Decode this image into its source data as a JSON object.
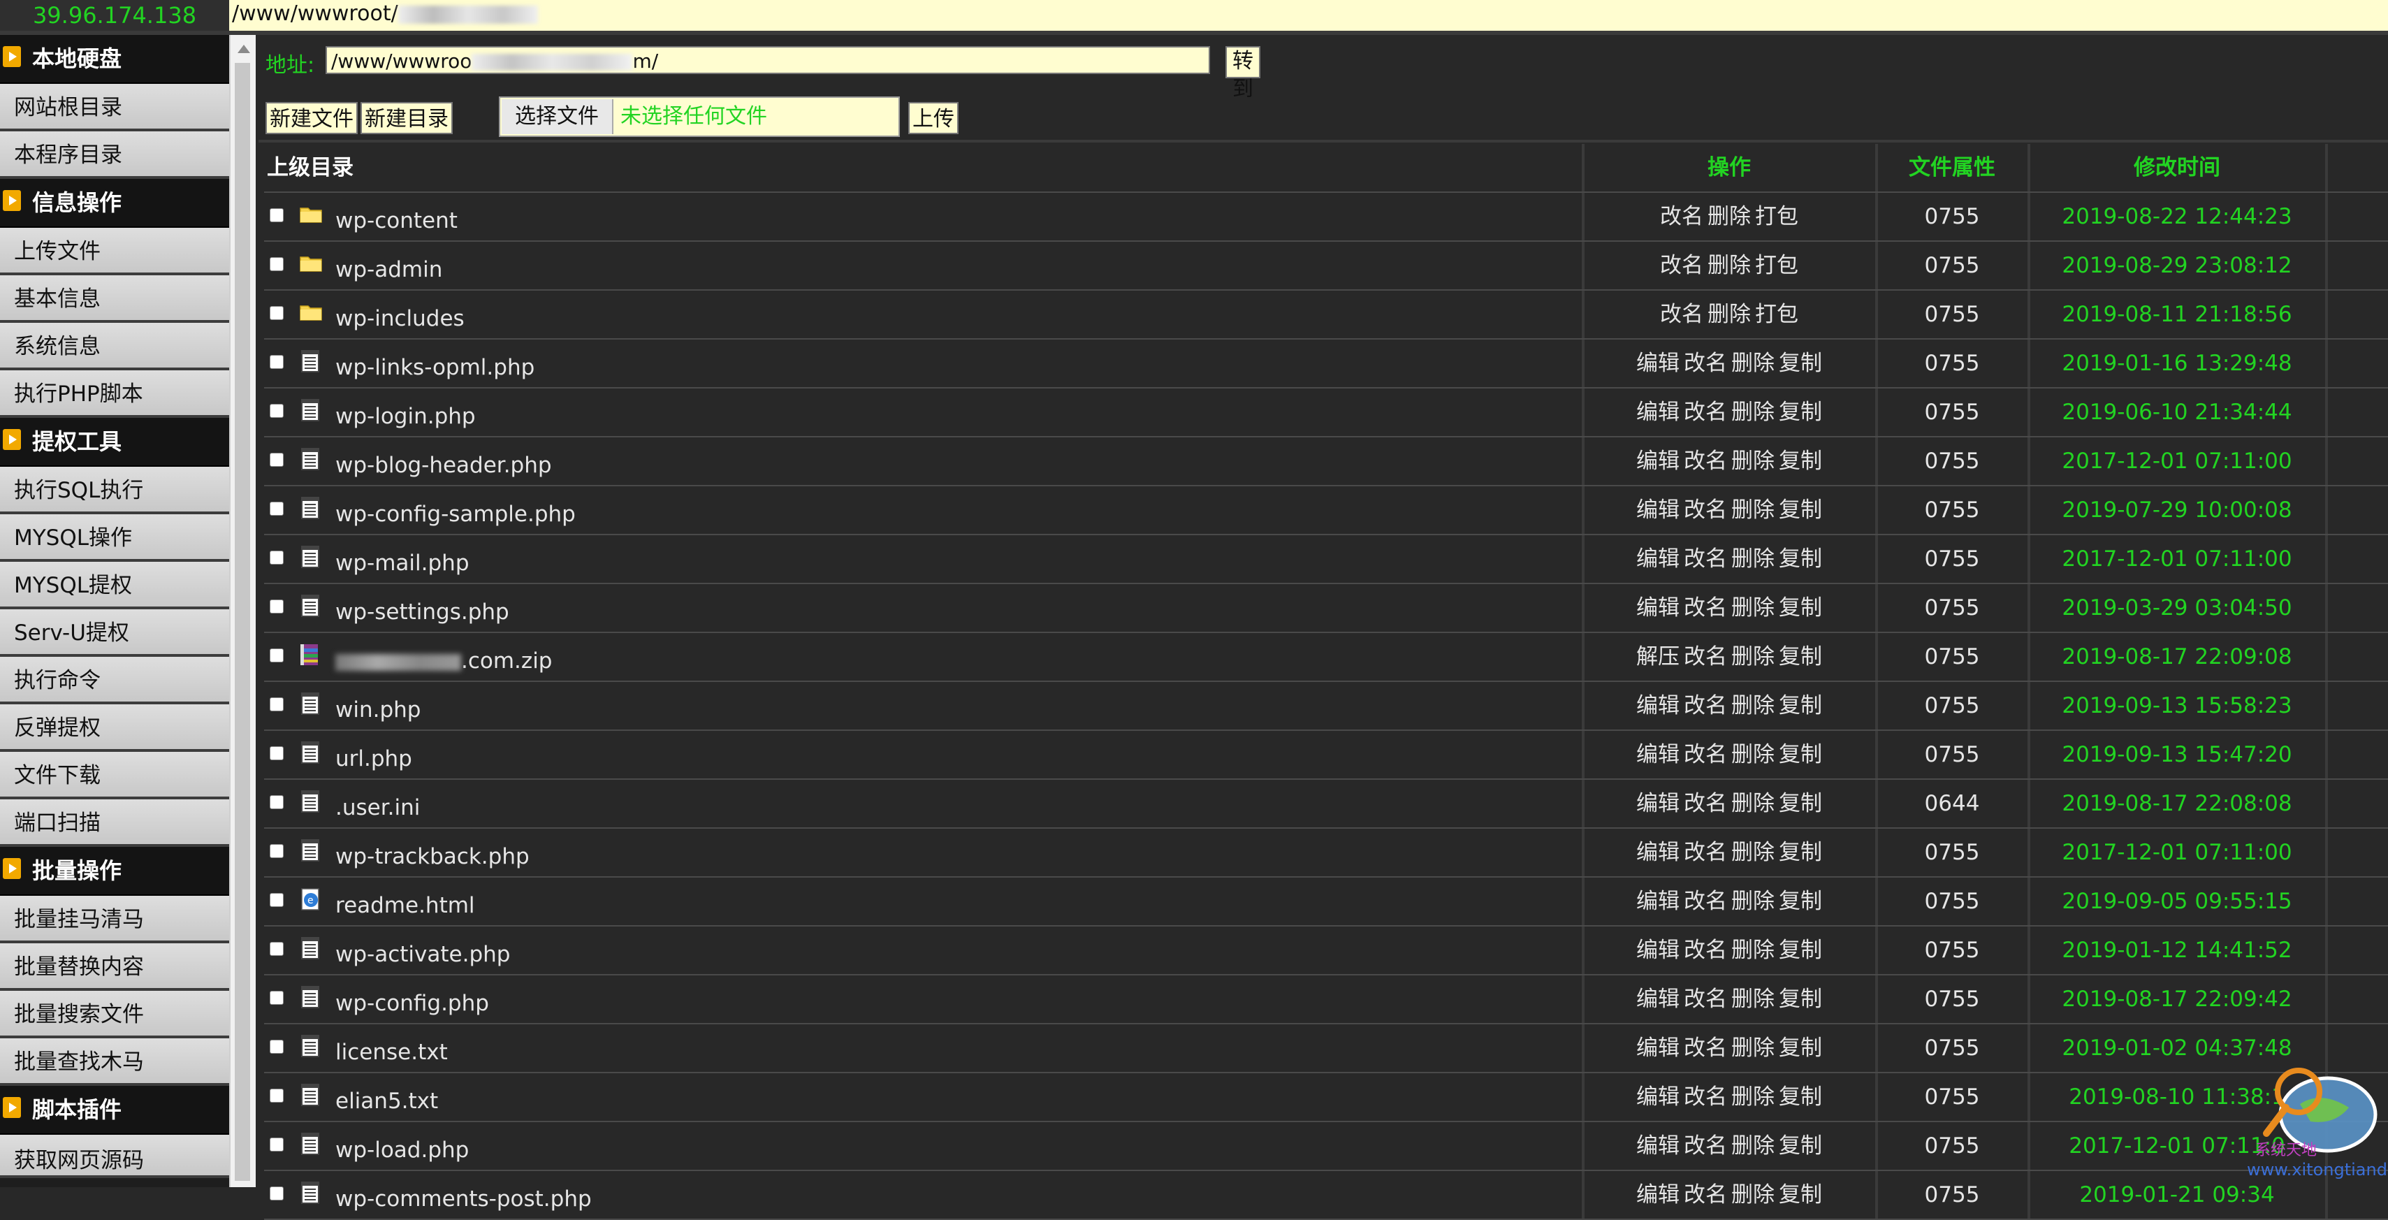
{
  "topbar": {
    "ip": "39.96.174.138",
    "path": "/www/wwwroot/"
  },
  "sidebar": {
    "sections": [
      {
        "title": "本地硬盘",
        "items": [
          "网站根目录",
          "本程序目录"
        ]
      },
      {
        "title": "信息操作",
        "items": [
          "上传文件",
          "基本信息",
          "系统信息",
          "执行PHP脚本"
        ]
      },
      {
        "title": "提权工具",
        "items": [
          "执行SQL执行",
          "MYSQL操作",
          "MYSQL提权",
          "Serv-U提权",
          "执行命令",
          "反弹提权",
          "文件下载",
          "端口扫描"
        ]
      },
      {
        "title": "批量操作",
        "items": [
          "批量挂马清马",
          "批量替换内容",
          "批量搜索文件",
          "批量查找木马"
        ]
      },
      {
        "title": "脚本插件",
        "items": [
          "获取网页源码"
        ]
      }
    ]
  },
  "toolbar": {
    "addr_label": "地址:",
    "addr_prefix": "/www/wwwroo",
    "addr_suffix": "m/",
    "go_label": "转到",
    "new_file_label": "新建文件",
    "new_dir_label": "新建目录",
    "choose_file_label": "选择文件",
    "no_file_label": "未选择任何文件",
    "upload_label": "上传"
  },
  "table": {
    "headers": {
      "name": "上级目录",
      "ops": "操作",
      "perm": "文件属性",
      "mtime": "修改时间"
    },
    "rows": [
      {
        "name": "wp-content",
        "icon": "folder-icon",
        "ops": [
          "改名",
          "删除",
          "打包"
        ],
        "perm": "0755",
        "mtime": "2019-08-22 12:44:23"
      },
      {
        "name": "wp-admin",
        "icon": "folder-icon",
        "ops": [
          "改名",
          "删除",
          "打包"
        ],
        "perm": "0755",
        "mtime": "2019-08-29 23:08:12"
      },
      {
        "name": "wp-includes",
        "icon": "folder-icon",
        "ops": [
          "改名",
          "删除",
          "打包"
        ],
        "perm": "0755",
        "mtime": "2019-08-11 21:18:56"
      },
      {
        "name": "wp-links-opml.php",
        "icon": "text-file-icon",
        "ops": [
          "编辑",
          "改名",
          "删除",
          "复制"
        ],
        "perm": "0755",
        "mtime": "2019-01-16 13:29:48"
      },
      {
        "name": "wp-login.php",
        "icon": "text-file-icon",
        "ops": [
          "编辑",
          "改名",
          "删除",
          "复制"
        ],
        "perm": "0755",
        "mtime": "2019-06-10 21:34:44"
      },
      {
        "name": "wp-blog-header.php",
        "icon": "text-file-icon",
        "ops": [
          "编辑",
          "改名",
          "删除",
          "复制"
        ],
        "perm": "0755",
        "mtime": "2017-12-01 07:11:00"
      },
      {
        "name": "wp-config-sample.php",
        "icon": "text-file-icon",
        "ops": [
          "编辑",
          "改名",
          "删除",
          "复制"
        ],
        "perm": "0755",
        "mtime": "2019-07-29 10:00:08"
      },
      {
        "name": "wp-mail.php",
        "icon": "text-file-icon",
        "ops": [
          "编辑",
          "改名",
          "删除",
          "复制"
        ],
        "perm": "0755",
        "mtime": "2017-12-01 07:11:00"
      },
      {
        "name": "wp-settings.php",
        "icon": "text-file-icon",
        "ops": [
          "编辑",
          "改名",
          "删除",
          "复制"
        ],
        "perm": "0755",
        "mtime": "2019-03-29 03:04:50"
      },
      {
        "name": ".com.zip",
        "icon": "archive-icon",
        "blurred": true,
        "ops": [
          "解压",
          "改名",
          "删除",
          "复制"
        ],
        "perm": "0755",
        "mtime": "2019-08-17 22:09:08"
      },
      {
        "name": "win.php",
        "icon": "text-file-icon",
        "ops": [
          "编辑",
          "改名",
          "删除",
          "复制"
        ],
        "perm": "0755",
        "mtime": "2019-09-13 15:58:23"
      },
      {
        "name": "url.php",
        "icon": "text-file-icon",
        "ops": [
          "编辑",
          "改名",
          "删除",
          "复制"
        ],
        "perm": "0755",
        "mtime": "2019-09-13 15:47:20"
      },
      {
        "name": ".user.ini",
        "icon": "text-file-icon",
        "ops": [
          "编辑",
          "改名",
          "删除",
          "复制"
        ],
        "perm": "0644",
        "mtime": "2019-08-17 22:08:08"
      },
      {
        "name": "wp-trackback.php",
        "icon": "text-file-icon",
        "ops": [
          "编辑",
          "改名",
          "删除",
          "复制"
        ],
        "perm": "0755",
        "mtime": "2017-12-01 07:11:00"
      },
      {
        "name": "readme.html",
        "icon": "html-file-icon",
        "ops": [
          "编辑",
          "改名",
          "删除",
          "复制"
        ],
        "perm": "0755",
        "mtime": "2019-09-05 09:55:15"
      },
      {
        "name": "wp-activate.php",
        "icon": "text-file-icon",
        "ops": [
          "编辑",
          "改名",
          "删除",
          "复制"
        ],
        "perm": "0755",
        "mtime": "2019-01-12 14:41:52"
      },
      {
        "name": "wp-config.php",
        "icon": "text-file-icon",
        "ops": [
          "编辑",
          "改名",
          "删除",
          "复制"
        ],
        "perm": "0755",
        "mtime": "2019-08-17 22:09:42"
      },
      {
        "name": "license.txt",
        "icon": "text-file-icon",
        "ops": [
          "编辑",
          "改名",
          "删除",
          "复制"
        ],
        "perm": "0755",
        "mtime": "2019-01-02 04:37:48"
      },
      {
        "name": "elian5.txt",
        "icon": "text-file-icon",
        "ops": [
          "编辑",
          "改名",
          "删除",
          "复制"
        ],
        "perm": "0755",
        "mtime": "2019-08-10 11:38:1"
      },
      {
        "name": "wp-load.php",
        "icon": "text-file-icon",
        "ops": [
          "编辑",
          "改名",
          "删除",
          "复制"
        ],
        "perm": "0755",
        "mtime": "2017-12-01 07:11:0"
      },
      {
        "name": "wp-comments-post.php",
        "icon": "text-file-icon",
        "ops": [
          "编辑",
          "改名",
          "删除",
          "复制"
        ],
        "perm": "0755",
        "mtime": "2019-01-21 09:34"
      }
    ]
  },
  "watermark": {
    "line1": "系统天地",
    "line2": "www.xitongtiandi.net"
  },
  "colors": {
    "accent_green": "#22d422",
    "input_bg": "#fffdd0",
    "bg": "#282828",
    "section_arrow": "#f2a900"
  }
}
